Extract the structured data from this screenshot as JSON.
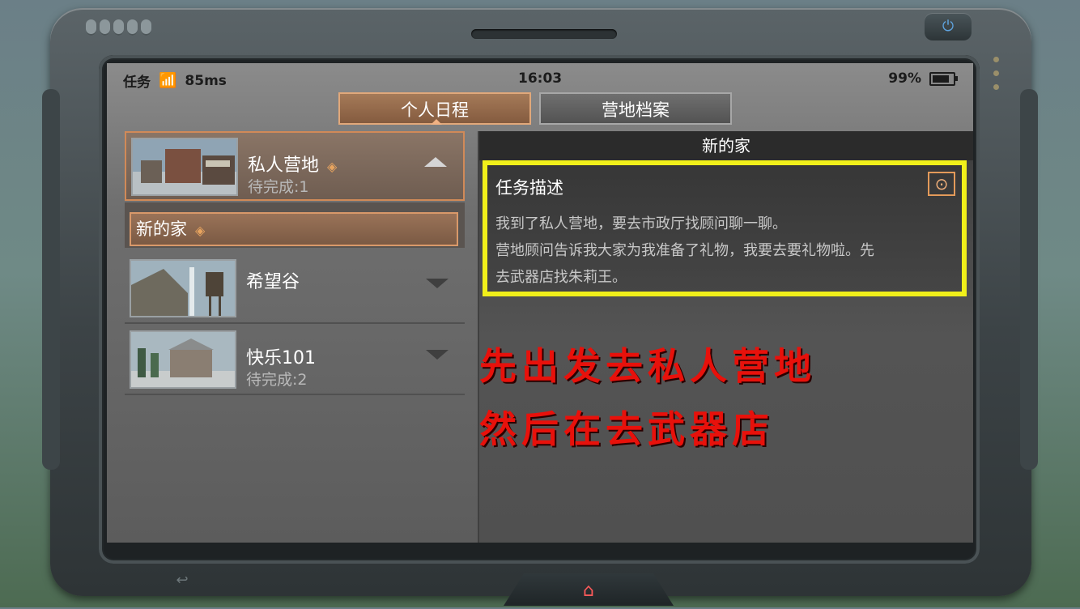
{
  "status_bar": {
    "app": "任务",
    "wifi_icon": "wifi-icon",
    "ping": "85ms",
    "time": "16:03",
    "battery": "99%",
    "battery_level": 0.99
  },
  "tabs": [
    {
      "label": "个人日程",
      "active": true
    },
    {
      "label": "营地档案",
      "active": false
    }
  ],
  "quest_list": [
    {
      "title": "私人营地",
      "status": "待完成:1",
      "expanded": true,
      "tracked": true
    },
    {
      "title": "希望谷",
      "status": "",
      "expanded": false,
      "tracked": false
    },
    {
      "title": "快乐101",
      "status": "待完成:2",
      "expanded": false,
      "tracked": false
    }
  ],
  "sub_quest": {
    "title": "新的家",
    "tracked": true
  },
  "detail": {
    "title": "新的家",
    "section_title": "任务描述",
    "description_lines": [
      "我到了私人营地，要去市政厅找顾问聊一聊。",
      "营地顾问告诉我大家为我准备了礼物，我要去要礼物啦。先",
      "去武器店找朱莉王。"
    ]
  },
  "annotation": {
    "line1": "先出发去私人营地",
    "line2": "然后在去武器店",
    "color": "#e8110b"
  },
  "colors": {
    "highlight_box": "#f1f01a",
    "accent": "#e1a87a"
  }
}
